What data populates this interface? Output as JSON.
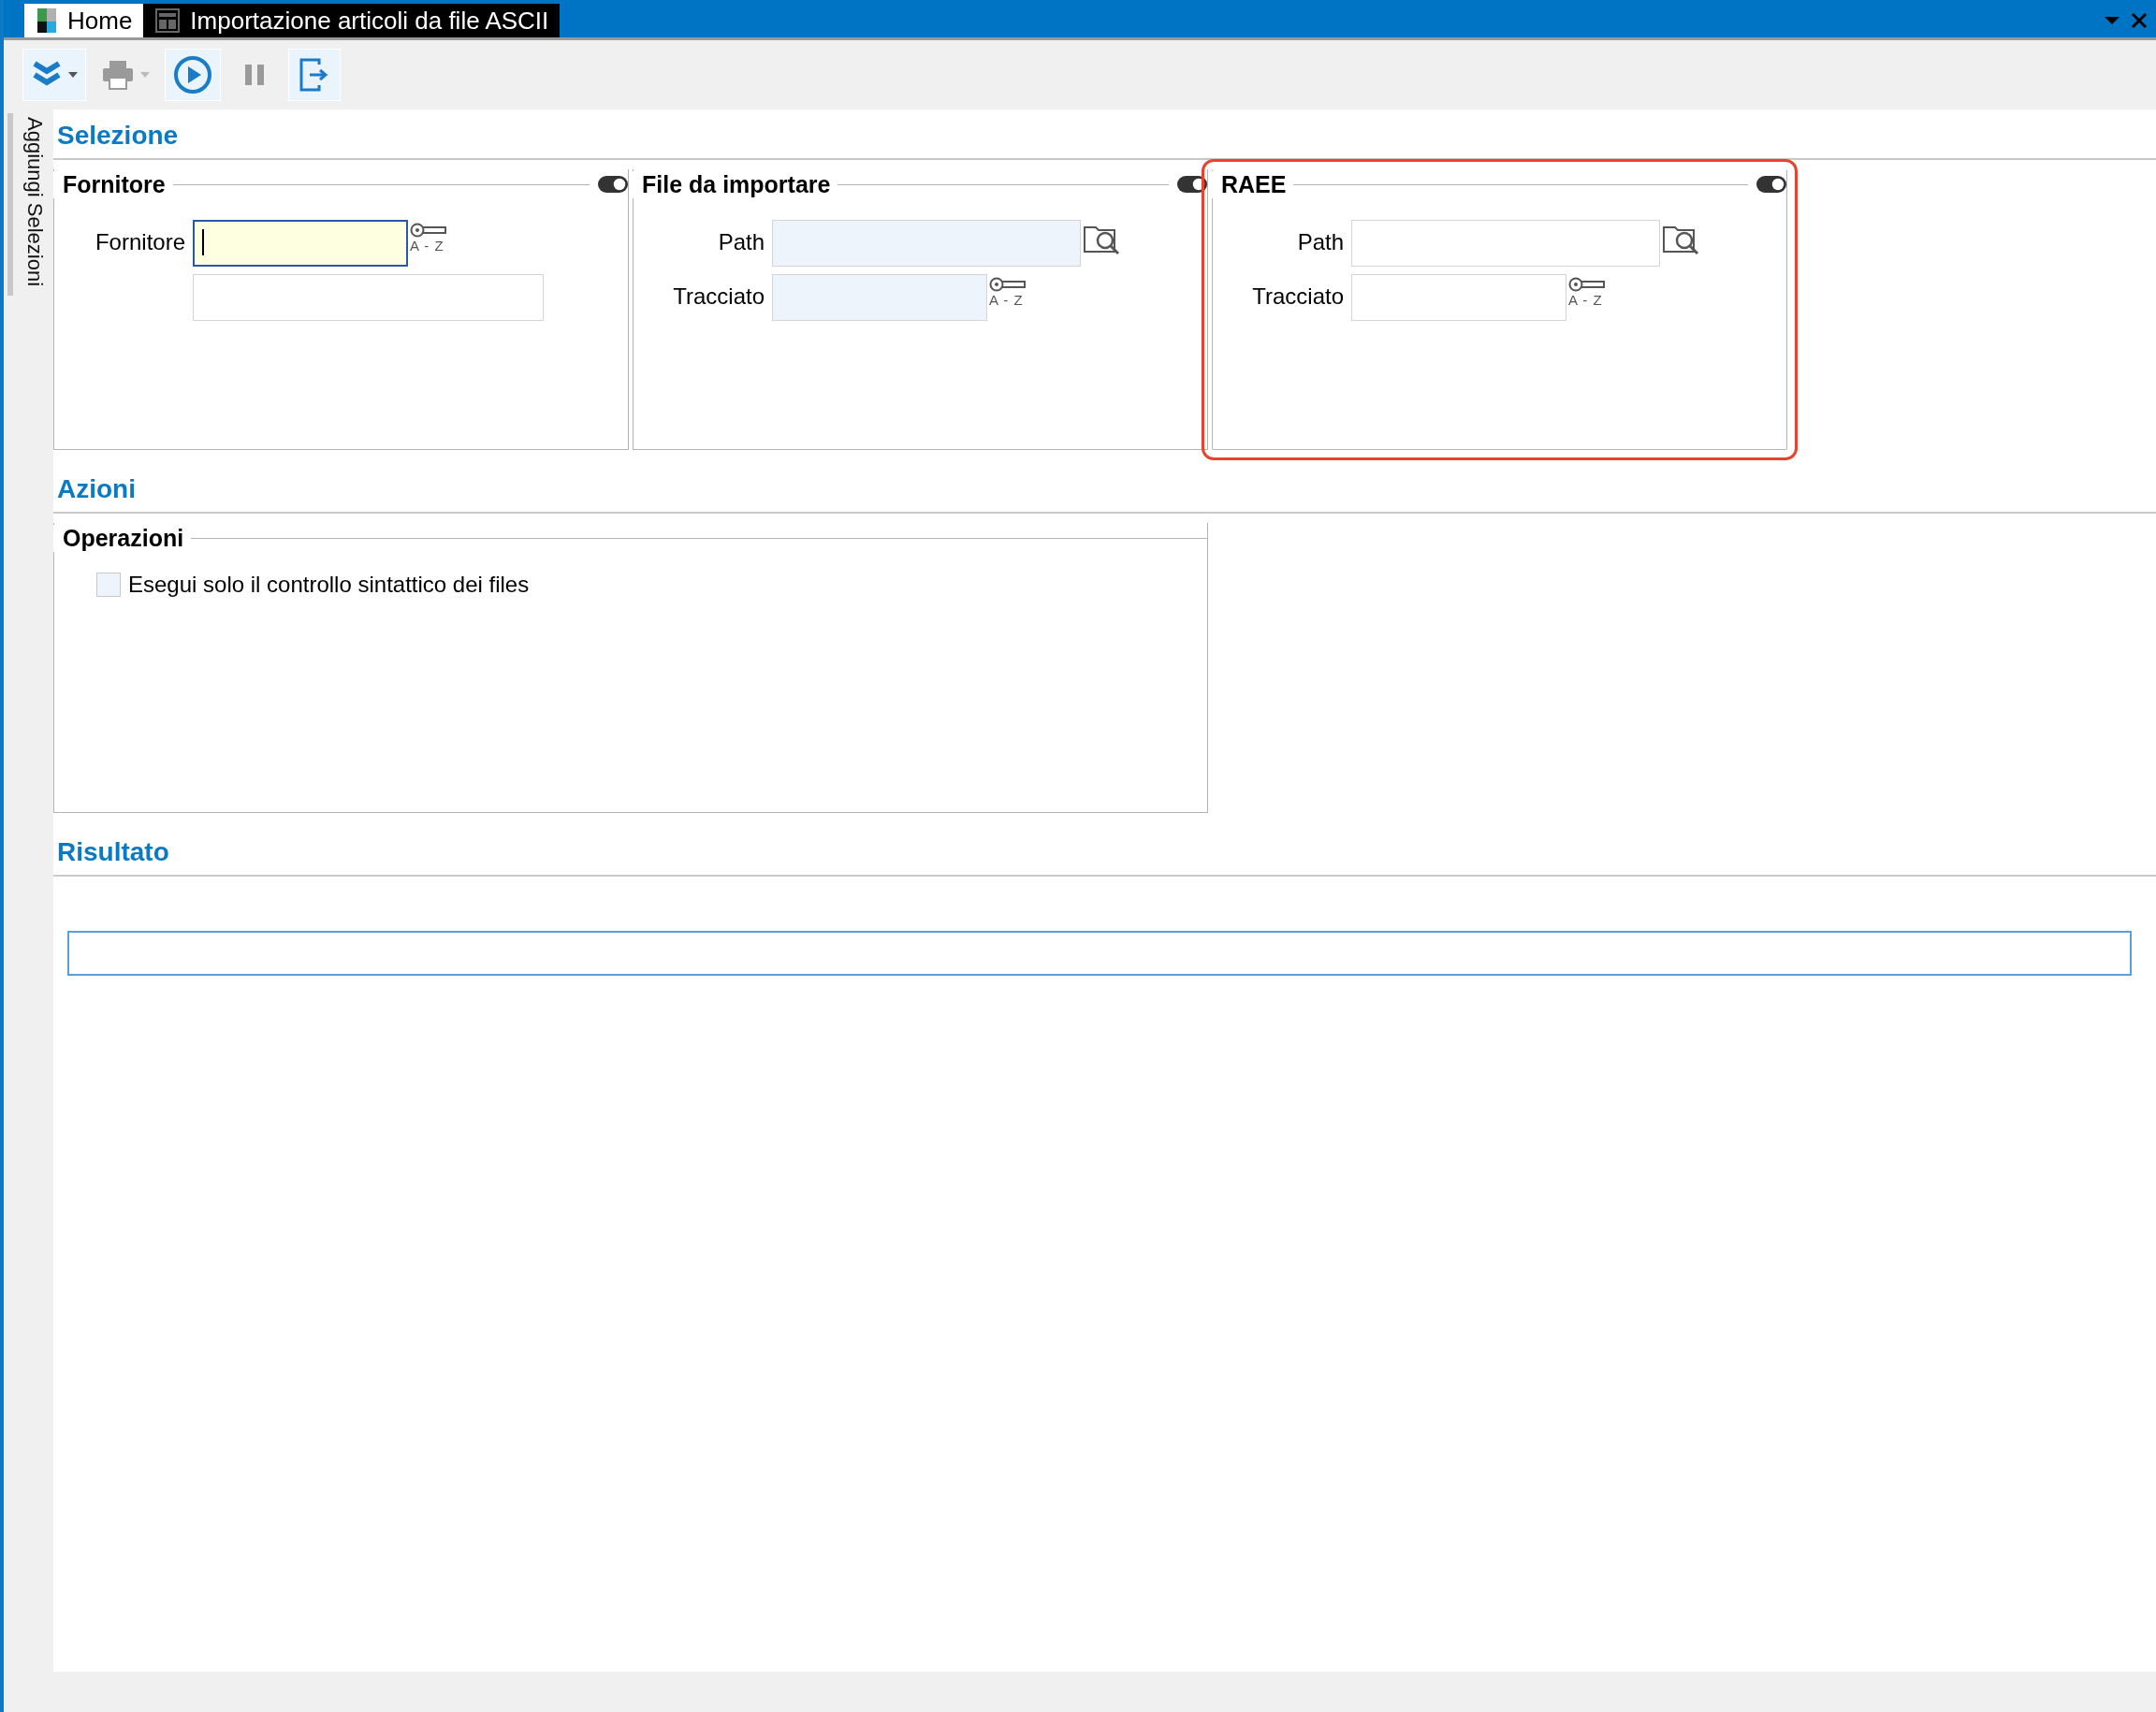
{
  "tabs": [
    {
      "label": "Home",
      "selected": false,
      "kind": "home"
    },
    {
      "label": "Importazione articoli da file ASCII",
      "selected": true,
      "kind": "form"
    }
  ],
  "toolbar": [
    {
      "kind": "expand",
      "disabled": false,
      "dropdown": true
    },
    {
      "kind": "print",
      "disabled": true,
      "dropdown": true
    },
    {
      "kind": "run",
      "disabled": false,
      "dropdown": false
    },
    {
      "kind": "pause",
      "disabled": true,
      "dropdown": false
    },
    {
      "kind": "exit",
      "disabled": false,
      "dropdown": false
    }
  ],
  "sidebar": {
    "label": "Aggiungi Selezioni"
  },
  "sections": [
    {
      "title": "Selezione",
      "groups": [
        {
          "title": "Fornitore",
          "toggle_on": true,
          "highlighted": false,
          "rows": [
            {
              "label": "Fornitore",
              "field": {
                "kind": "code",
                "focused": true
              },
              "button": {
                "kind": "lookup",
                "text": "A - Z"
              }
            },
            {
              "field": {
                "kind": "description",
                "focused": false,
                "required": false
              }
            }
          ]
        },
        {
          "title": "File da importare",
          "toggle_on": true,
          "highlighted": false,
          "rows": [
            {
              "label": "Path",
              "field": {
                "kind": "path",
                "focused": false,
                "required": true
              },
              "button": {
                "kind": "browse"
              }
            },
            {
              "label": "Tracciato",
              "field": {
                "kind": "code",
                "focused": false,
                "required": true
              },
              "button": {
                "kind": "lookup",
                "text": "A - Z"
              }
            }
          ]
        },
        {
          "title": "RAEE",
          "toggle_on": true,
          "highlighted": true,
          "rows": [
            {
              "label": "Path",
              "field": {
                "kind": "path",
                "focused": false,
                "required": false
              },
              "button": {
                "kind": "browse"
              }
            },
            {
              "label": "Tracciato",
              "field": {
                "kind": "code",
                "focused": false,
                "required": false
              },
              "button": {
                "kind": "lookup",
                "text": "A - Z"
              }
            }
          ]
        }
      ]
    },
    {
      "title": "Azioni",
      "groups": [
        {
          "title": "Operazioni",
          "wide": true,
          "checkboxes": [
            {
              "label": "Esegui solo il controllo sintattico dei files",
              "checked": false
            }
          ]
        }
      ]
    },
    {
      "title": "Risultato",
      "kind": "result"
    }
  ]
}
